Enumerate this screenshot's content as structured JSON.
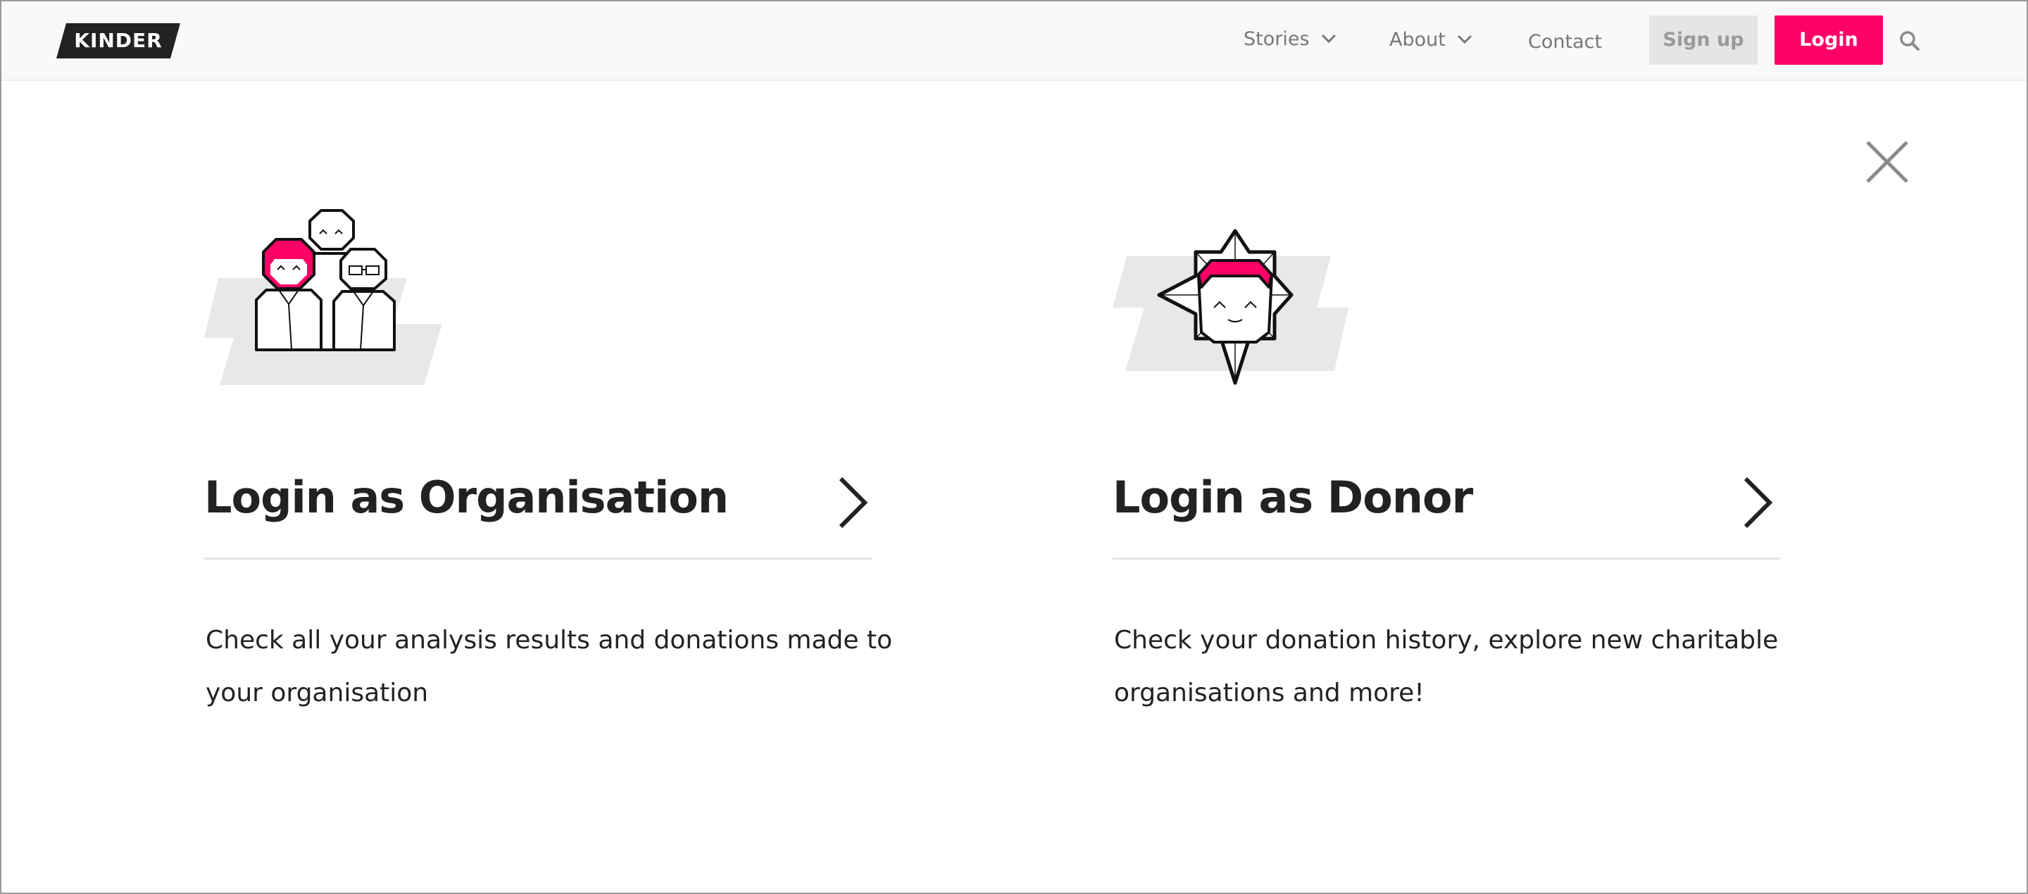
{
  "header": {
    "logo_text": "KINDER",
    "nav": {
      "stories": "Stories",
      "about": "About",
      "contact": "Contact"
    },
    "signup_label": "Sign up",
    "login_label": "Login"
  },
  "colors": {
    "accent": "#ff0066",
    "header_bg": "#f9f9f9",
    "signup_bg": "#e5e5e5",
    "text": "#222222",
    "muted": "#777777"
  },
  "icons": [
    "chevron-down-icon",
    "search-icon",
    "close-icon",
    "chevron-right-icon"
  ],
  "cards": [
    {
      "title": "Login as Organisation",
      "description": "Check all your analysis results and donations made to your organisation",
      "illustration": "organisation-group-illustration"
    },
    {
      "title": "Login as Donor",
      "description": "Check your donation history, explore new charitable organisations and more!",
      "illustration": "donor-badge-illustration"
    }
  ]
}
